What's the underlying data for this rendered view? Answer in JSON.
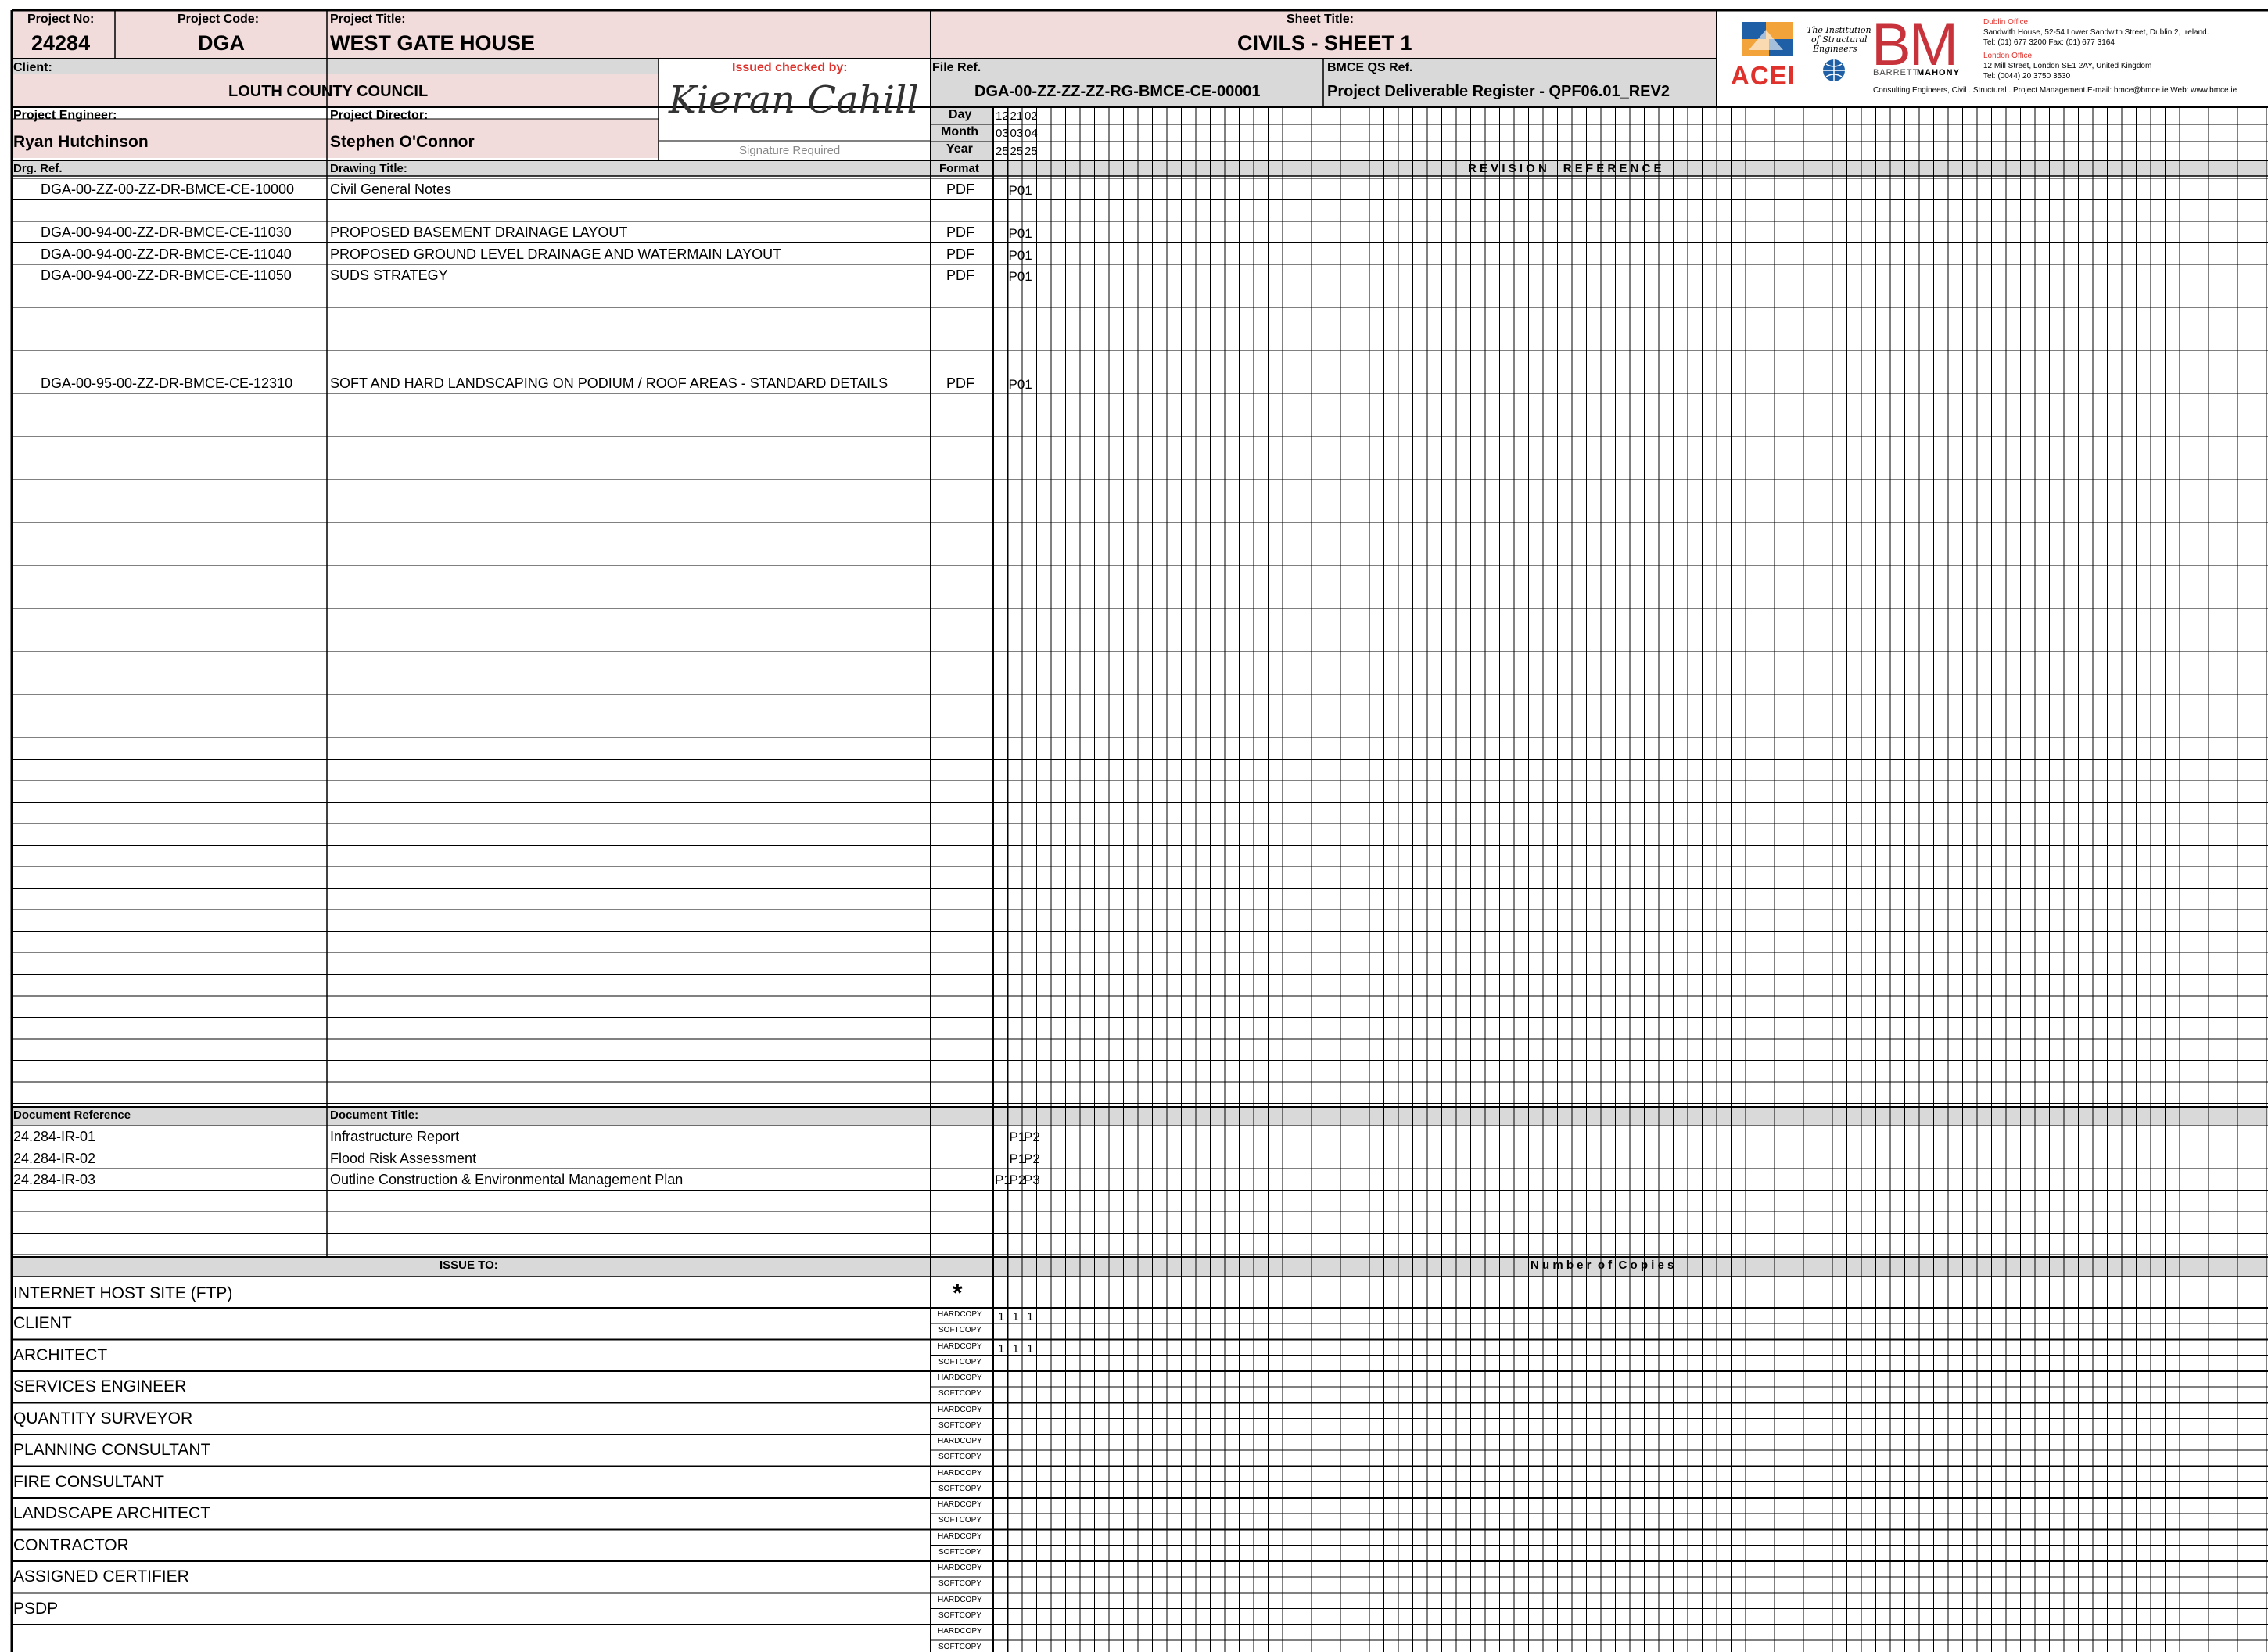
{
  "header": {
    "project_no_label": "Project No:",
    "project_no": "24284",
    "project_code_label": "Project Code:",
    "project_code": "DGA",
    "project_title_label": "Project Title:",
    "project_title": "WEST GATE HOUSE",
    "sheet_title_label": "Sheet Title:",
    "sheet_title": "CIVILS - SHEET 1",
    "client_label": "Client:",
    "client": "LOUTH COUNTY COUNCIL",
    "issued_checked_label": "Issued checked by:",
    "signature_name": "Kieran Cahill",
    "signature_required": "Signature Required",
    "file_ref_label": "File Ref.",
    "file_ref": "DGA-00-ZZ-ZZ-ZZ-RG-BMCE-CE-00001",
    "qs_ref_label": "BMCE QS Ref.",
    "qs_ref": "Project Deliverable Register - QPF06.01_REV2",
    "engineer_label": "Project Engineer:",
    "engineer": "Ryan Hutchinson",
    "director_label": "Project Director:",
    "director": "Stephen O'Connor"
  },
  "logos": {
    "acei": "ACEI",
    "istruct": [
      "The Institution",
      "of Structural",
      "Engineers"
    ],
    "bm": "BM",
    "barrett": "BARRETT",
    "mahony": "MAHONY",
    "dublin_label": "Dublin Office:",
    "dublin_address": "Sandwith House, 52-54 Lower Sandwith Street, Dublin 2, Ireland.",
    "dublin_tel": "Tel: (01) 677 3200  Fax: (01) 677 3164",
    "london_label": "London Office:",
    "london_address": "12 Mill Street, London SE1 2AY, United Kingdom",
    "london_tel": "Tel: (0044) 20 3750 3530",
    "tagline": "Consulting Engineers, Civil . Structural . Project Management.E-mail: bmce@bmce.ie  Web: www.bmce.ie"
  },
  "dates": {
    "day_label": "Day",
    "month_label": "Month",
    "year_label": "Year",
    "columns": [
      {
        "day": "12",
        "month": "03",
        "year": "25"
      },
      {
        "day": "21",
        "month": "03",
        "year": "25"
      },
      {
        "day": "02",
        "month": "04",
        "year": "25"
      }
    ]
  },
  "drawings_header": {
    "drg_ref": "Drg. Ref.",
    "title": "Drawing Title:",
    "format": "Format",
    "revision": "R E V I S I O N     R E F E R E N C E"
  },
  "drawings": [
    {
      "row": 0,
      "ref": "DGA-00-ZZ-00-ZZ-DR-BMCE-CE-10000",
      "title": "Civil General Notes",
      "format": "PDF",
      "revs": [
        {
          "col": 1,
          "v": "P01"
        }
      ]
    },
    {
      "row": 2,
      "ref": "DGA-00-94-00-ZZ-DR-BMCE-CE-11030",
      "title": "PROPOSED BASEMENT DRAINAGE LAYOUT",
      "format": "PDF",
      "revs": [
        {
          "col": 1,
          "v": "P01"
        }
      ]
    },
    {
      "row": 3,
      "ref": "DGA-00-94-00-ZZ-DR-BMCE-CE-11040",
      "title": "PROPOSED GROUND LEVEL DRAINAGE AND WATERMAIN LAYOUT",
      "format": "PDF",
      "revs": [
        {
          "col": 1,
          "v": "P01"
        }
      ]
    },
    {
      "row": 4,
      "ref": "DGA-00-94-00-ZZ-DR-BMCE-CE-11050",
      "title": "SUDS STRATEGY",
      "format": "PDF",
      "revs": [
        {
          "col": 1,
          "v": "P01"
        }
      ]
    },
    {
      "row": 9,
      "ref": "DGA-00-95-00-ZZ-DR-BMCE-CE-12310",
      "title": "SOFT AND HARD LANDSCAPING ON PODIUM / ROOF AREAS - STANDARD DETAILS",
      "format": "PDF",
      "revs": [
        {
          "col": 1,
          "v": "P01"
        }
      ]
    }
  ],
  "documents_header": {
    "ref": "Document Reference",
    "title": "Document Title:"
  },
  "documents": [
    {
      "row": 0,
      "ref": "24.284-IR-01",
      "title": "Infrastructure Report",
      "revs": [
        {
          "col": 1,
          "v": "P1"
        },
        {
          "col": 2,
          "v": "P2"
        }
      ]
    },
    {
      "row": 1,
      "ref": "24.284-IR-02",
      "title": "Flood Risk Assessment",
      "revs": [
        {
          "col": 1,
          "v": "P1"
        },
        {
          "col": 2,
          "v": "P2"
        }
      ]
    },
    {
      "row": 2,
      "ref": "24.284-IR-03",
      "title": "Outline Construction & Environmental Management Plan",
      "revs": [
        {
          "col": 0,
          "v": "P1"
        },
        {
          "col": 1,
          "v": "P2"
        },
        {
          "col": 2,
          "v": "P3"
        }
      ]
    }
  ],
  "issue": {
    "issue_to_label": "ISSUE TO:",
    "copies_label": "N u m b e r  o f  C o p i e s",
    "ftp_label": "INTERNET HOST SITE (FTP)",
    "ftp_mark": "*",
    "hardcopy": "HARDCOPY",
    "softcopy": "SOFTCOPY",
    "recipients": [
      {
        "name": "CLIENT",
        "hard": [
          "1",
          "1",
          "1"
        ]
      },
      {
        "name": "ARCHITECT",
        "hard": [
          "1",
          "1",
          "1"
        ]
      },
      {
        "name": "SERVICES ENGINEER",
        "hard": []
      },
      {
        "name": "QUANTITY SURVEYOR",
        "hard": []
      },
      {
        "name": "PLANNING CONSULTANT",
        "hard": []
      },
      {
        "name": "FIRE CONSULTANT",
        "hard": []
      },
      {
        "name": "LANDSCAPE ARCHITECT",
        "hard": []
      },
      {
        "name": "CONTRACTOR",
        "hard": []
      },
      {
        "name": "ASSIGNED CERTIFIER",
        "hard": []
      },
      {
        "name": "PSDP",
        "hard": []
      },
      {
        "name": "",
        "hard": []
      }
    ]
  },
  "colors": {
    "pink": "#f2dcdb",
    "gray": "#d9d9d9",
    "red": "#e0322c",
    "blue": "#1f5fa6",
    "orange": "#f08a24"
  }
}
